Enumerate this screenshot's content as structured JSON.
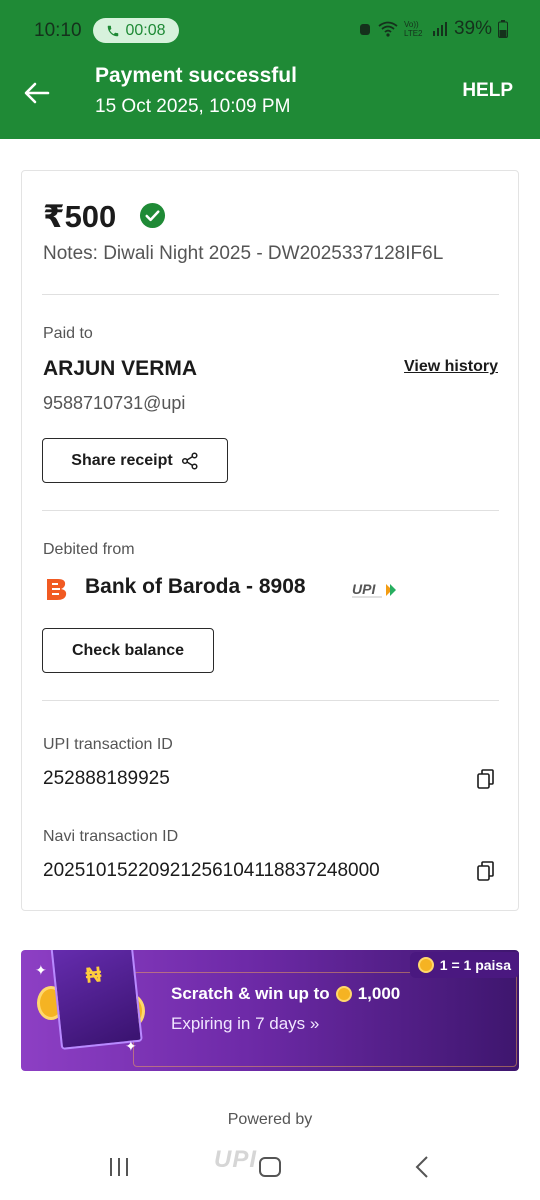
{
  "status_bar": {
    "time": "10:10",
    "call_timer": "00:08",
    "network_label": "Vo)) LTE2",
    "battery": "39%"
  },
  "header": {
    "title": "Payment successful",
    "subtitle": "15 Oct 2025, 10:09 PM",
    "help_label": "HELP",
    "background_color": "#1f8a36"
  },
  "receipt": {
    "amount": "₹500",
    "notes": "Notes: Diwali Night 2025 - DW2025337128IF6L",
    "paid_to_label": "Paid to",
    "payee_name": "ARJUN VERMA",
    "view_history_label": "View history",
    "payee_upi_id": "9588710731@upi",
    "share_receipt_label": "Share receipt",
    "debited_from_label": "Debited from",
    "bank_name": "Bank of Baroda - 8908",
    "bank_tag": "UPI",
    "check_balance_label": "Check balance",
    "upi_txn_label": "UPI transaction ID",
    "upi_txn_id": "252888189925",
    "navi_txn_label": "Navi transaction ID",
    "navi_txn_id": "202510152209212561041188372480​00"
  },
  "rewards_banner": {
    "badge_text": "1 = 1 paisa",
    "title_prefix": "Scratch & win up to",
    "title_value": "1,000",
    "subtitle": "Expiring in 7 days »"
  },
  "footer": {
    "powered_by": "Powered by",
    "upi_logo_text": "UPI"
  },
  "icons": [
    "back-arrow-icon",
    "phone-icon",
    "check-circle-icon",
    "share-icon",
    "bank-of-baroda-logo",
    "upi-logo",
    "copy-icon",
    "coin-icon"
  ]
}
